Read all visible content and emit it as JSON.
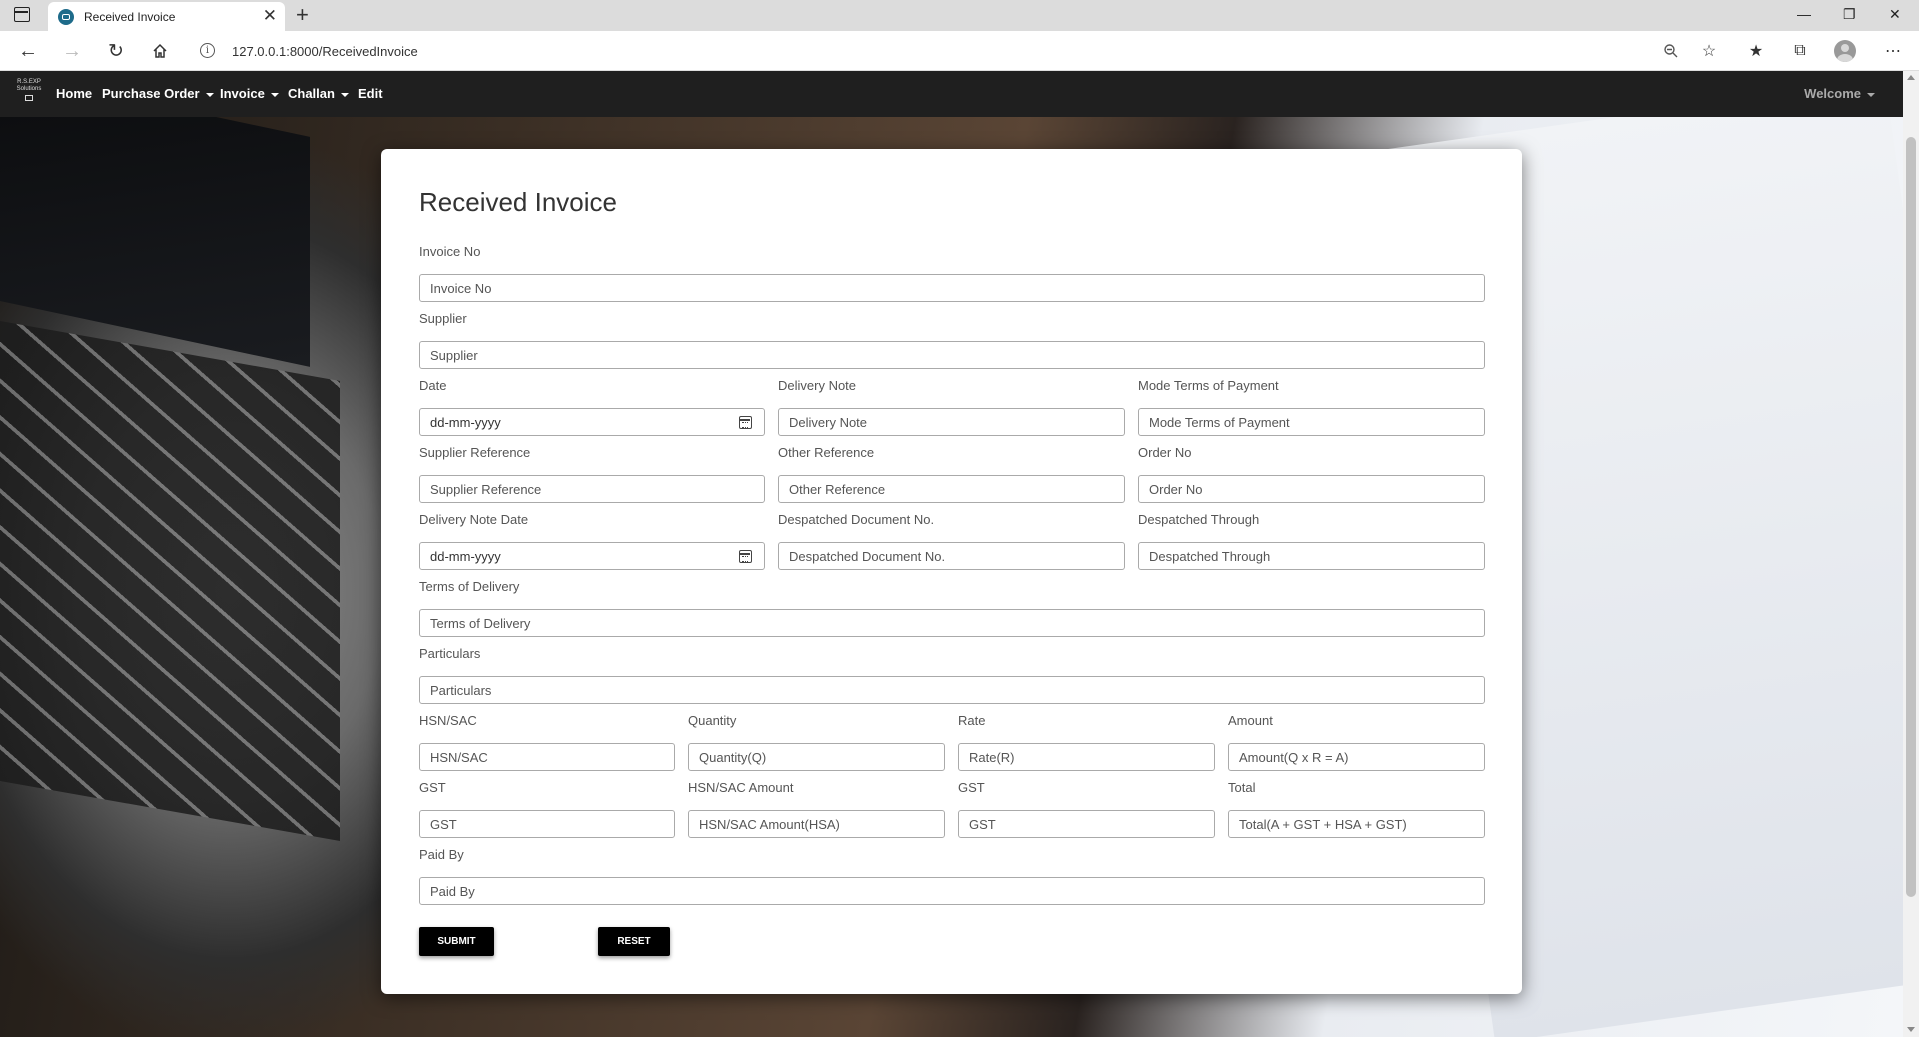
{
  "browser": {
    "tab_title": "Received Invoice",
    "tab_close": "✕",
    "new_tab": "+",
    "url": "127.0.0.1:8000/ReceivedInvoice",
    "window_controls": {
      "minimize": "—",
      "restore": "❐",
      "close": "✕"
    }
  },
  "navbar": {
    "brand_line1": "R.S.EXP",
    "brand_line2": "Solutions",
    "items": [
      {
        "label": "Home",
        "dropdown": false
      },
      {
        "label": "Purchase Order",
        "dropdown": true
      },
      {
        "label": "Invoice",
        "dropdown": true
      },
      {
        "label": "Challan",
        "dropdown": true
      },
      {
        "label": "Edit",
        "dropdown": false
      }
    ],
    "welcome": "Welcome"
  },
  "form": {
    "title": "Received Invoice",
    "invoice_no": {
      "label": "Invoice No",
      "placeholder": "Invoice No"
    },
    "supplier": {
      "label": "Supplier",
      "placeholder": "Supplier"
    },
    "date": {
      "label": "Date",
      "value": "dd-mm-yyyy"
    },
    "delivery_note": {
      "label": "Delivery Note",
      "placeholder": "Delivery Note"
    },
    "mode_terms": {
      "label": "Mode Terms of Payment",
      "placeholder": "Mode Terms of Payment"
    },
    "supplier_ref": {
      "label": "Supplier Reference",
      "placeholder": "Supplier Reference"
    },
    "other_ref": {
      "label": "Other Reference",
      "placeholder": "Other Reference"
    },
    "order_no": {
      "label": "Order No",
      "placeholder": "Order No"
    },
    "delivery_note_date": {
      "label": "Delivery Note Date",
      "value": "dd-mm-yyyy"
    },
    "despatched_doc": {
      "label": "Despatched Document No.",
      "placeholder": "Despatched Document No."
    },
    "despatched_through": {
      "label": "Despatched Through",
      "placeholder": "Despatched Through"
    },
    "terms_delivery": {
      "label": "Terms of Delivery",
      "placeholder": "Terms of Delivery"
    },
    "particulars": {
      "label": "Particulars",
      "placeholder": "Particulars"
    },
    "hsn_sac": {
      "label": "HSN/SAC",
      "placeholder": "HSN/SAC"
    },
    "quantity": {
      "label": "Quantity",
      "placeholder": "Quantity(Q)"
    },
    "rate": {
      "label": "Rate",
      "placeholder": "Rate(R)"
    },
    "amount": {
      "label": "Amount",
      "placeholder": "Amount(Q x R = A)"
    },
    "gst1": {
      "label": "GST",
      "placeholder": "GST"
    },
    "hsn_amount": {
      "label": "HSN/SAC Amount",
      "placeholder": "HSN/SAC Amount(HSA)"
    },
    "gst2": {
      "label": "GST",
      "placeholder": "GST"
    },
    "total": {
      "label": "Total",
      "placeholder": "Total(A + GST + HSA + GST)"
    },
    "paid_by": {
      "label": "Paid By",
      "placeholder": "Paid By"
    },
    "submit_label": "SUBMIT",
    "reset_label": "RESET"
  }
}
